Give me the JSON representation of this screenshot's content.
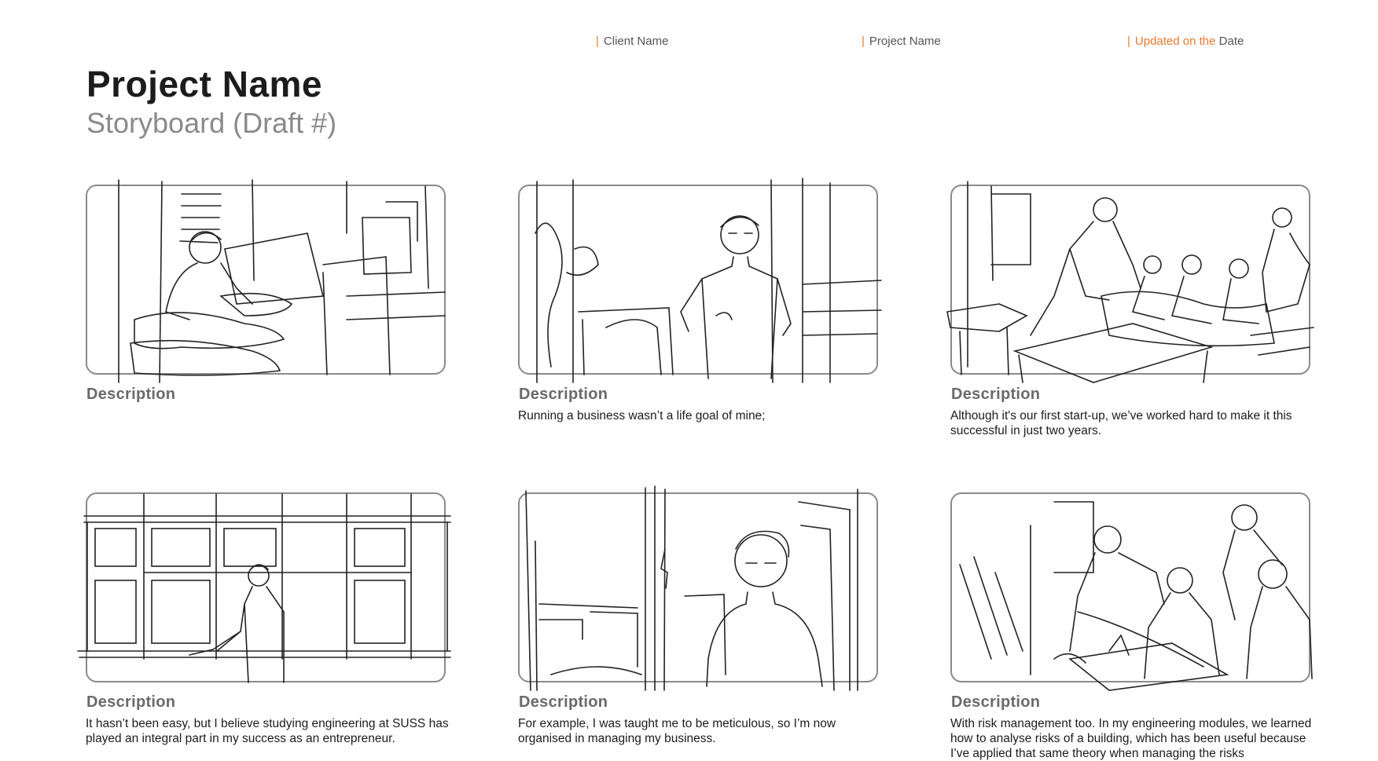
{
  "header": {
    "client": "Client Name",
    "project": "Project Name",
    "updated_prefix": "Updated on the",
    "updated_suffix": "Date"
  },
  "title": "Project Name",
  "subtitle": "Storyboard (Draft #)",
  "panels": [
    {
      "heading": "Description",
      "text": ""
    },
    {
      "heading": "Description",
      "text": "Running a business wasn’t a life goal of mine;"
    },
    {
      "heading": "Description",
      "text": "Although it's our first start-up, we’ve worked hard to make it this successful in just two years."
    },
    {
      "heading": "Description",
      "text": "It hasn’t been easy, but I believe studying engineering at SUSS has played an integral part in my success as an entrepreneur."
    },
    {
      "heading": "Description",
      "text": "For example, I was taught me to be meticulous, so I’m now organised in managing my business."
    },
    {
      "heading": "Description",
      "text": "With risk management too. In my engineering modules, we learned how to analyse risks of a building, which has been useful because I’ve applied that same theory when managing the risks"
    }
  ]
}
